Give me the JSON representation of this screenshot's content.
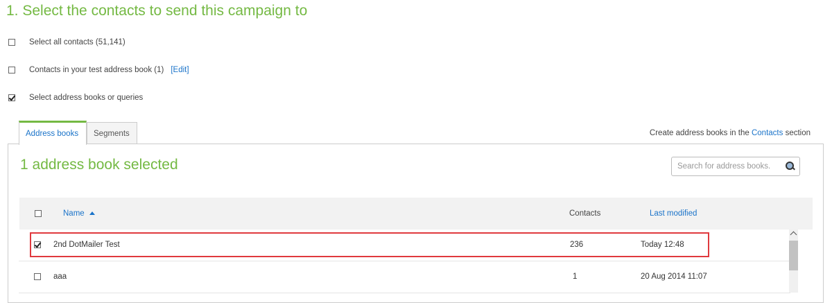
{
  "heading": "1. Select the contacts to send this campaign to",
  "options": {
    "all_contacts": {
      "label": "Select all contacts (51,141)",
      "checked": false
    },
    "test_book": {
      "label": "Contacts in your test address book (1)",
      "edit_link": "[Edit]",
      "checked": false
    },
    "books_or_queries": {
      "label": "Select address books or queries",
      "checked": true
    }
  },
  "tabs": [
    {
      "label": "Address books",
      "active": true
    },
    {
      "label": "Segments",
      "active": false
    }
  ],
  "create_note": {
    "prefix": "Create address books in the",
    "link": "Contacts",
    "suffix": "section"
  },
  "panel": {
    "selected_count": "1 address book selected",
    "search_placeholder": "Search for address books."
  },
  "table": {
    "columns": {
      "name": "Name",
      "contacts": "Contacts",
      "last_modified": "Last modified"
    },
    "sort_column": "Name",
    "sort_direction": "ascending",
    "rows": [
      {
        "name": "2nd DotMailer Test",
        "contacts": "236",
        "last_modified": "Today 12:48",
        "checked": true,
        "highlighted": true
      },
      {
        "name": "aaa",
        "contacts": "1",
        "last_modified": "20 Aug 2014 11:07",
        "checked": false,
        "highlighted": false
      }
    ]
  },
  "colors": {
    "accent_green": "#74b943",
    "link_blue": "#1a73c9",
    "highlight_red": "#e0393e"
  }
}
